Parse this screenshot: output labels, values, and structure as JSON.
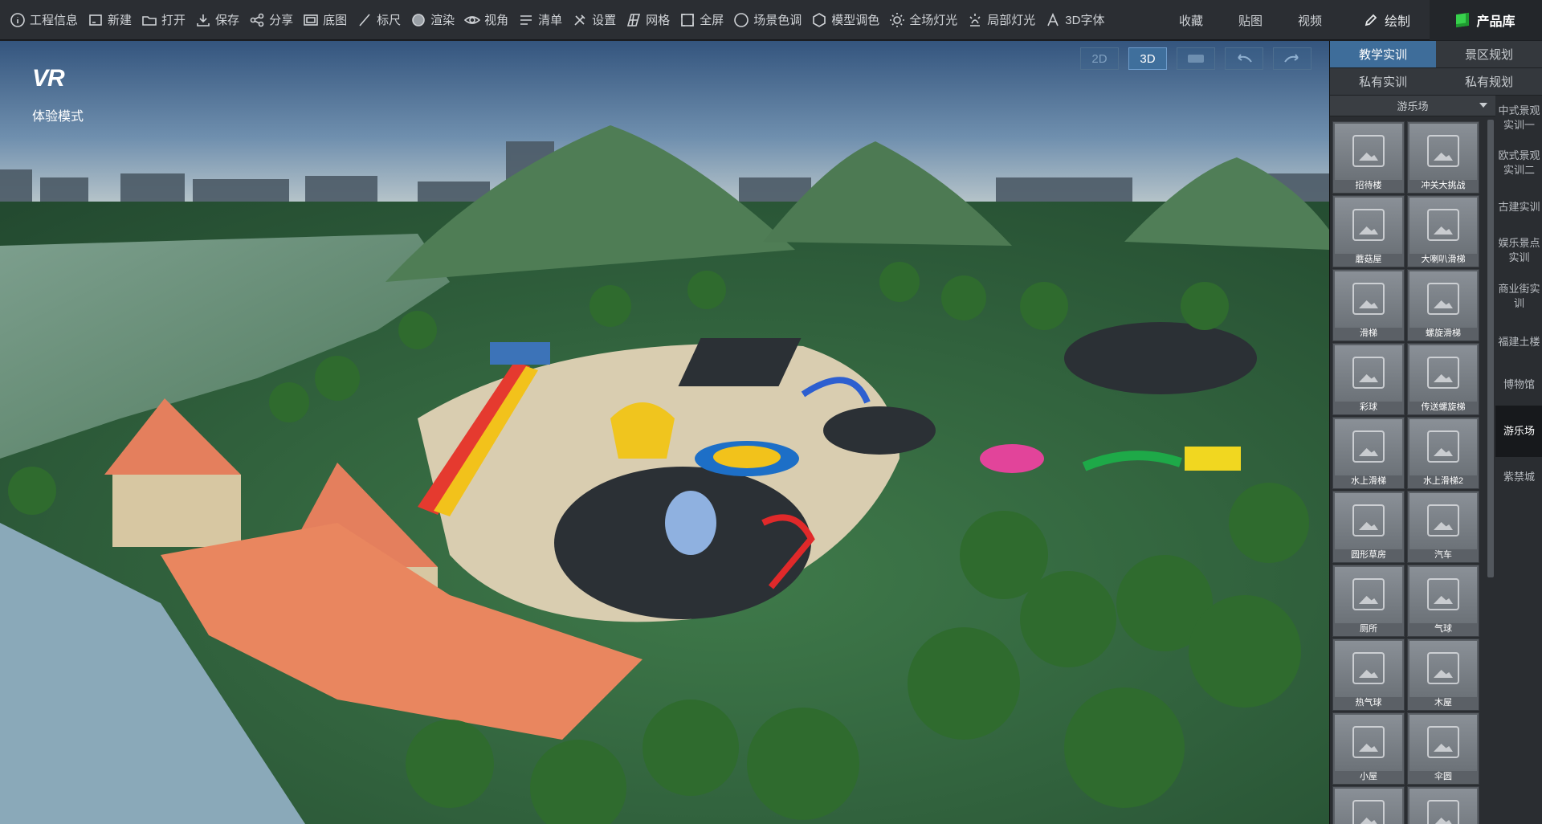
{
  "toolbar": {
    "items": [
      {
        "label": "工程信息",
        "icon": "info-icon"
      },
      {
        "label": "新建",
        "icon": "new-file-icon"
      },
      {
        "label": "打开",
        "icon": "open-folder-icon"
      },
      {
        "label": "保存",
        "icon": "save-icon"
      },
      {
        "label": "分享",
        "icon": "share-icon"
      },
      {
        "label": "底图",
        "icon": "basemap-icon"
      },
      {
        "label": "标尺",
        "icon": "ruler-icon"
      },
      {
        "label": "渲染",
        "icon": "render-icon"
      },
      {
        "label": "视角",
        "icon": "eye-icon"
      },
      {
        "label": "清单",
        "icon": "list-icon"
      },
      {
        "label": "设置",
        "icon": "settings-icon"
      },
      {
        "label": "网格",
        "icon": "grid-icon"
      },
      {
        "label": "全屏",
        "icon": "fullscreen-icon"
      },
      {
        "label": "场景色调",
        "icon": "scene-tone-icon"
      },
      {
        "label": "模型调色",
        "icon": "model-color-icon"
      },
      {
        "label": "全场灯光",
        "icon": "global-light-icon"
      },
      {
        "label": "局部灯光",
        "icon": "local-light-icon"
      },
      {
        "label": "3D字体",
        "icon": "font-3d-icon"
      }
    ],
    "right": {
      "collect": "收藏",
      "paste": "贴图",
      "video": "视频",
      "draw": "绘制",
      "library": "产品库"
    }
  },
  "viewport": {
    "logo": "VR",
    "mode": "体验模式",
    "view_buttons": [
      "2D",
      "3D"
    ]
  },
  "panel": {
    "tabs": [
      "教学实训",
      "景区规划",
      "私有实训",
      "私有规划"
    ],
    "category": "游乐场",
    "assets": [
      "招待楼",
      "冲关大挑战",
      "蘑菇屋",
      "大喇叭滑梯",
      "滑梯",
      "螺旋滑梯",
      "彩球",
      "传送螺旋梯",
      "水上滑梯",
      "水上滑梯2",
      "圆形草房",
      "汽车",
      "厕所",
      "气球",
      "热气球",
      "木屋",
      "小屋",
      "伞圆",
      "",
      ""
    ],
    "side_categories": [
      "中式景观实训一",
      "欧式景观实训二",
      "古建实训",
      "娱乐景点实训",
      "商业街实训",
      "福建土楼",
      "博物馆",
      "游乐场",
      "紫禁城"
    ]
  },
  "colors": {
    "accent": "#3e6d9a",
    "toolbar_bg": "#2b2e33",
    "panel_bg": "#2a2d31",
    "library_icon": "#37d14c"
  }
}
